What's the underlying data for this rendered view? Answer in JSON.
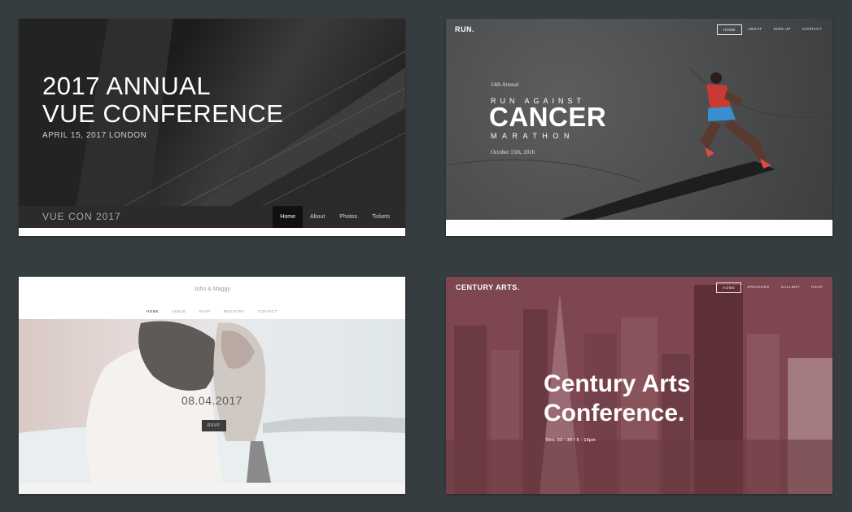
{
  "cards": {
    "vue": {
      "title_line1": "2017 ANNUAL",
      "title_line2": "VUE CONFERENCE",
      "date": "APRIL 15, 2017 LONDON",
      "brand": "VUE CON 2017",
      "nav": [
        "Home",
        "About",
        "Photos",
        "Tickets"
      ]
    },
    "run": {
      "logo": "RUN.",
      "nav": [
        "HOME",
        "ABOUT",
        "SIGN UP",
        "CONTACT"
      ],
      "annual": "14th Annual",
      "run_against": "RUN AGAINST",
      "cancer": "CANCER",
      "marathon": "MARATHON",
      "date": "October 15th, 2016"
    },
    "wedding": {
      "couple": "John & Maggy",
      "nav": [
        "HOME",
        "VENUE",
        "RSVP",
        "REGISTRY",
        "CONTACT"
      ],
      "date": "08.04.2017",
      "rsvp": "RSVP"
    },
    "arts": {
      "logo": "CENTURY ARTS.",
      "nav": [
        "HOME",
        "SPEAKERS",
        "GALLERY",
        "RSVP"
      ],
      "headline_line1": "Century Arts",
      "headline_line2": "Conference.",
      "date": "Dec. 23 - 30 / 5 - 10pm"
    }
  }
}
